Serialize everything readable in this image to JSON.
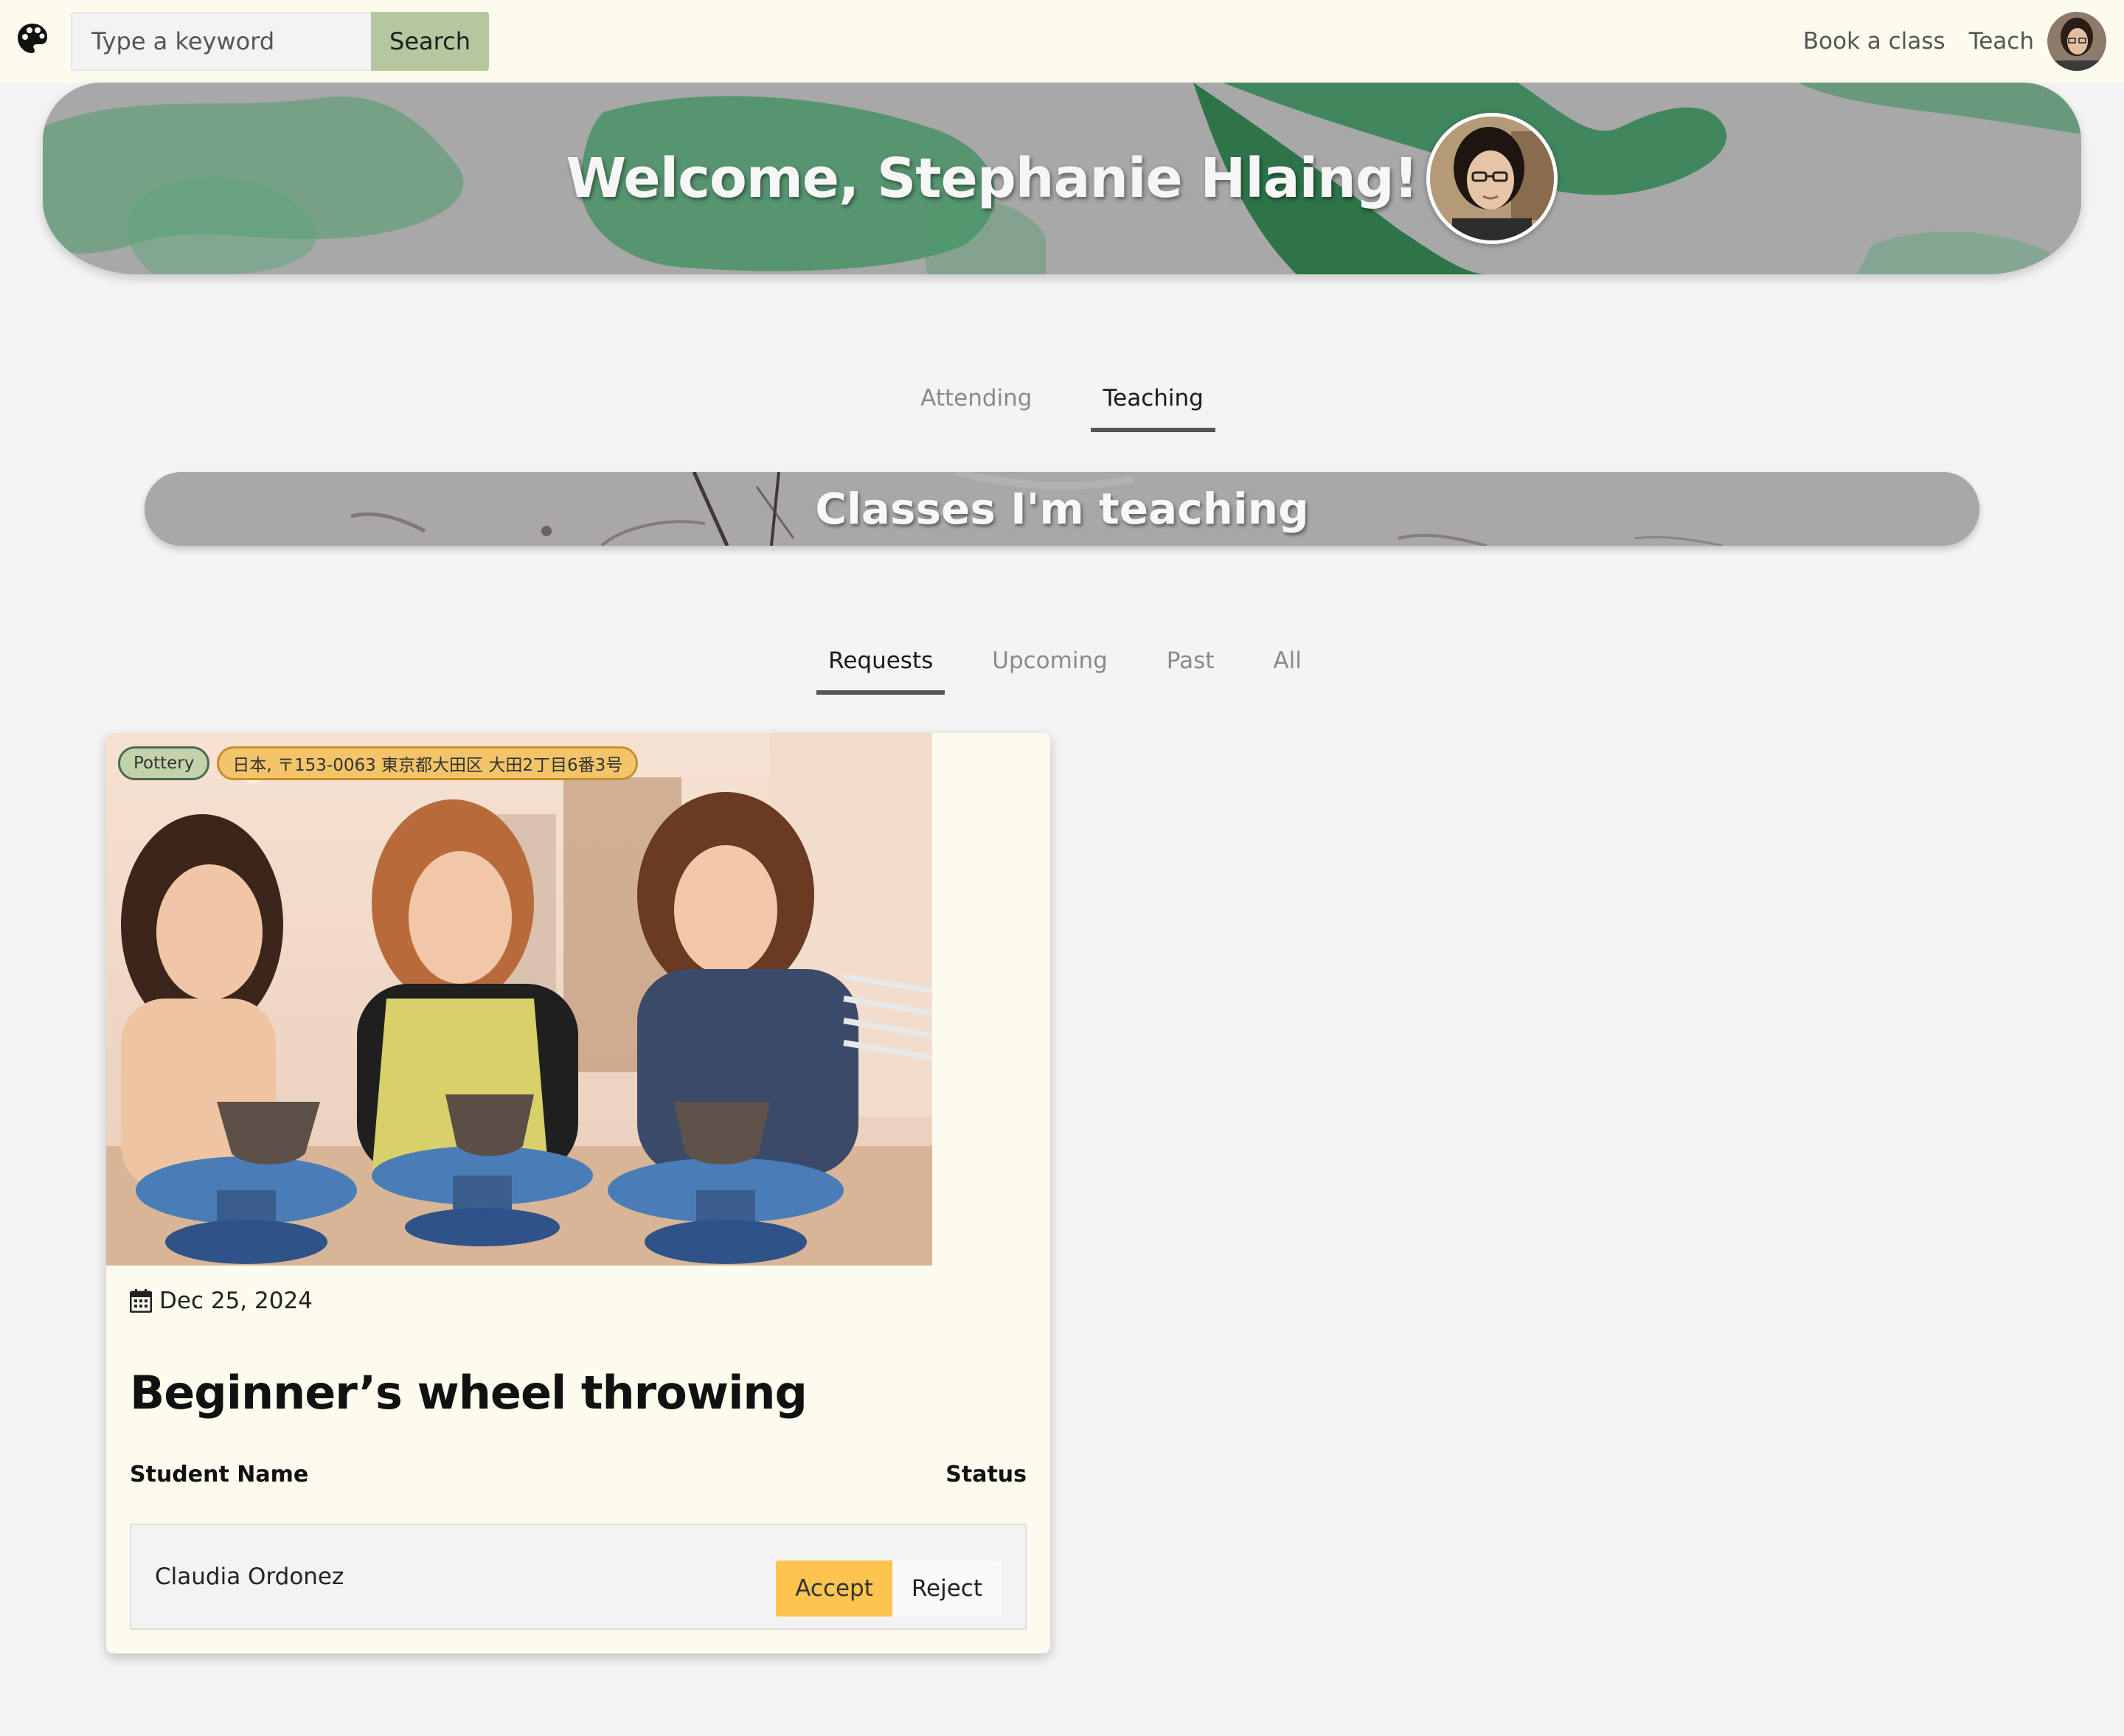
{
  "navbar": {
    "logo_icon": "palette-icon",
    "search": {
      "placeholder": "Type a keyword",
      "value": "",
      "button_label": "Search"
    },
    "links": {
      "book": "Book a class",
      "teach": "Teach"
    },
    "avatar_icon": "user-avatar"
  },
  "hero": {
    "title": "Welcome, Stephanie Hlaing!",
    "avatar_icon": "profile-photo"
  },
  "main_tabs": [
    {
      "label": "Attending",
      "active": false
    },
    {
      "label": "Teaching",
      "active": true
    }
  ],
  "section": {
    "title": "Classes I'm teaching"
  },
  "sub_tabs": [
    {
      "label": "Requests",
      "active": true
    },
    {
      "label": "Upcoming",
      "active": false
    },
    {
      "label": "Past",
      "active": false
    },
    {
      "label": "All",
      "active": false
    }
  ],
  "class_card": {
    "category": "Pottery",
    "location": "日本, 〒153-0063 東京都大田区 大田2丁目6番3号",
    "date_icon": "calendar-icon",
    "date": "Dec 25, 2024",
    "title": "Beginner’s wheel throwing",
    "columns": {
      "name": "Student Name",
      "status": "Status"
    },
    "requests": [
      {
        "student": "Claudia Ordonez",
        "accept_label": "Accept",
        "reject_label": "Reject"
      }
    ]
  },
  "colors": {
    "nav_bg": "#fdfbee",
    "search_button": "#b5c79f",
    "accept": "#fdc44f",
    "chip_category": "#c2d3ac",
    "chip_location": "#f4c46a"
  }
}
